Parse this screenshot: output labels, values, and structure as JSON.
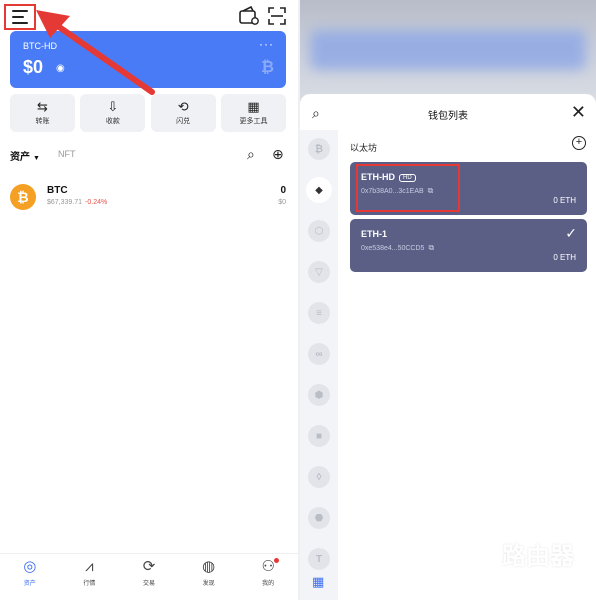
{
  "left": {
    "card": {
      "wallet_name": "BTC-HD",
      "balance": "$0",
      "more": "···"
    },
    "actions": [
      {
        "label": "转账",
        "icon": "⇆"
      },
      {
        "label": "收款",
        "icon": "⇩"
      },
      {
        "label": "闪兑",
        "icon": "⟲"
      },
      {
        "label": "更多工具",
        "icon": "▦"
      }
    ],
    "tabs": {
      "assets": "资产",
      "nft": "NFT"
    },
    "assets": [
      {
        "symbol": "BTC",
        "price": "$67,339.71",
        "change": "-0.24%",
        "quantity": "0",
        "value": "$0"
      }
    ],
    "bottom_nav": [
      {
        "label": "资产",
        "icon": "◎"
      },
      {
        "label": "行情",
        "icon": "⩘"
      },
      {
        "label": "交易",
        "icon": "⟳"
      },
      {
        "label": "发现",
        "icon": "◍"
      },
      {
        "label": "我的",
        "icon": "⚇"
      }
    ]
  },
  "right": {
    "sheet_title": "钱包列表",
    "section_title": "以太坊",
    "chains": [
      "₿",
      "◆",
      "⬡",
      "▽",
      "≡",
      "∞",
      "⬢",
      "■",
      "◊",
      "⬣",
      "T"
    ],
    "wallets": [
      {
        "name": "ETH-HD",
        "tag": "HD",
        "address": "0x7b38A0...3c1EAB",
        "balance": "0 ETH"
      },
      {
        "name": "ETH-1",
        "tag": "",
        "address": "0xe538e4...50CCD5",
        "balance": "0 ETH",
        "selected": true
      }
    ]
  },
  "watermark": {
    "title": "路由器",
    "subtitle": "luyouqi.com"
  },
  "colors": {
    "accent": "#4a7bf7",
    "wallet_card": "#5b5f86",
    "highlight": "#e53935",
    "btc": "#f4a024"
  }
}
